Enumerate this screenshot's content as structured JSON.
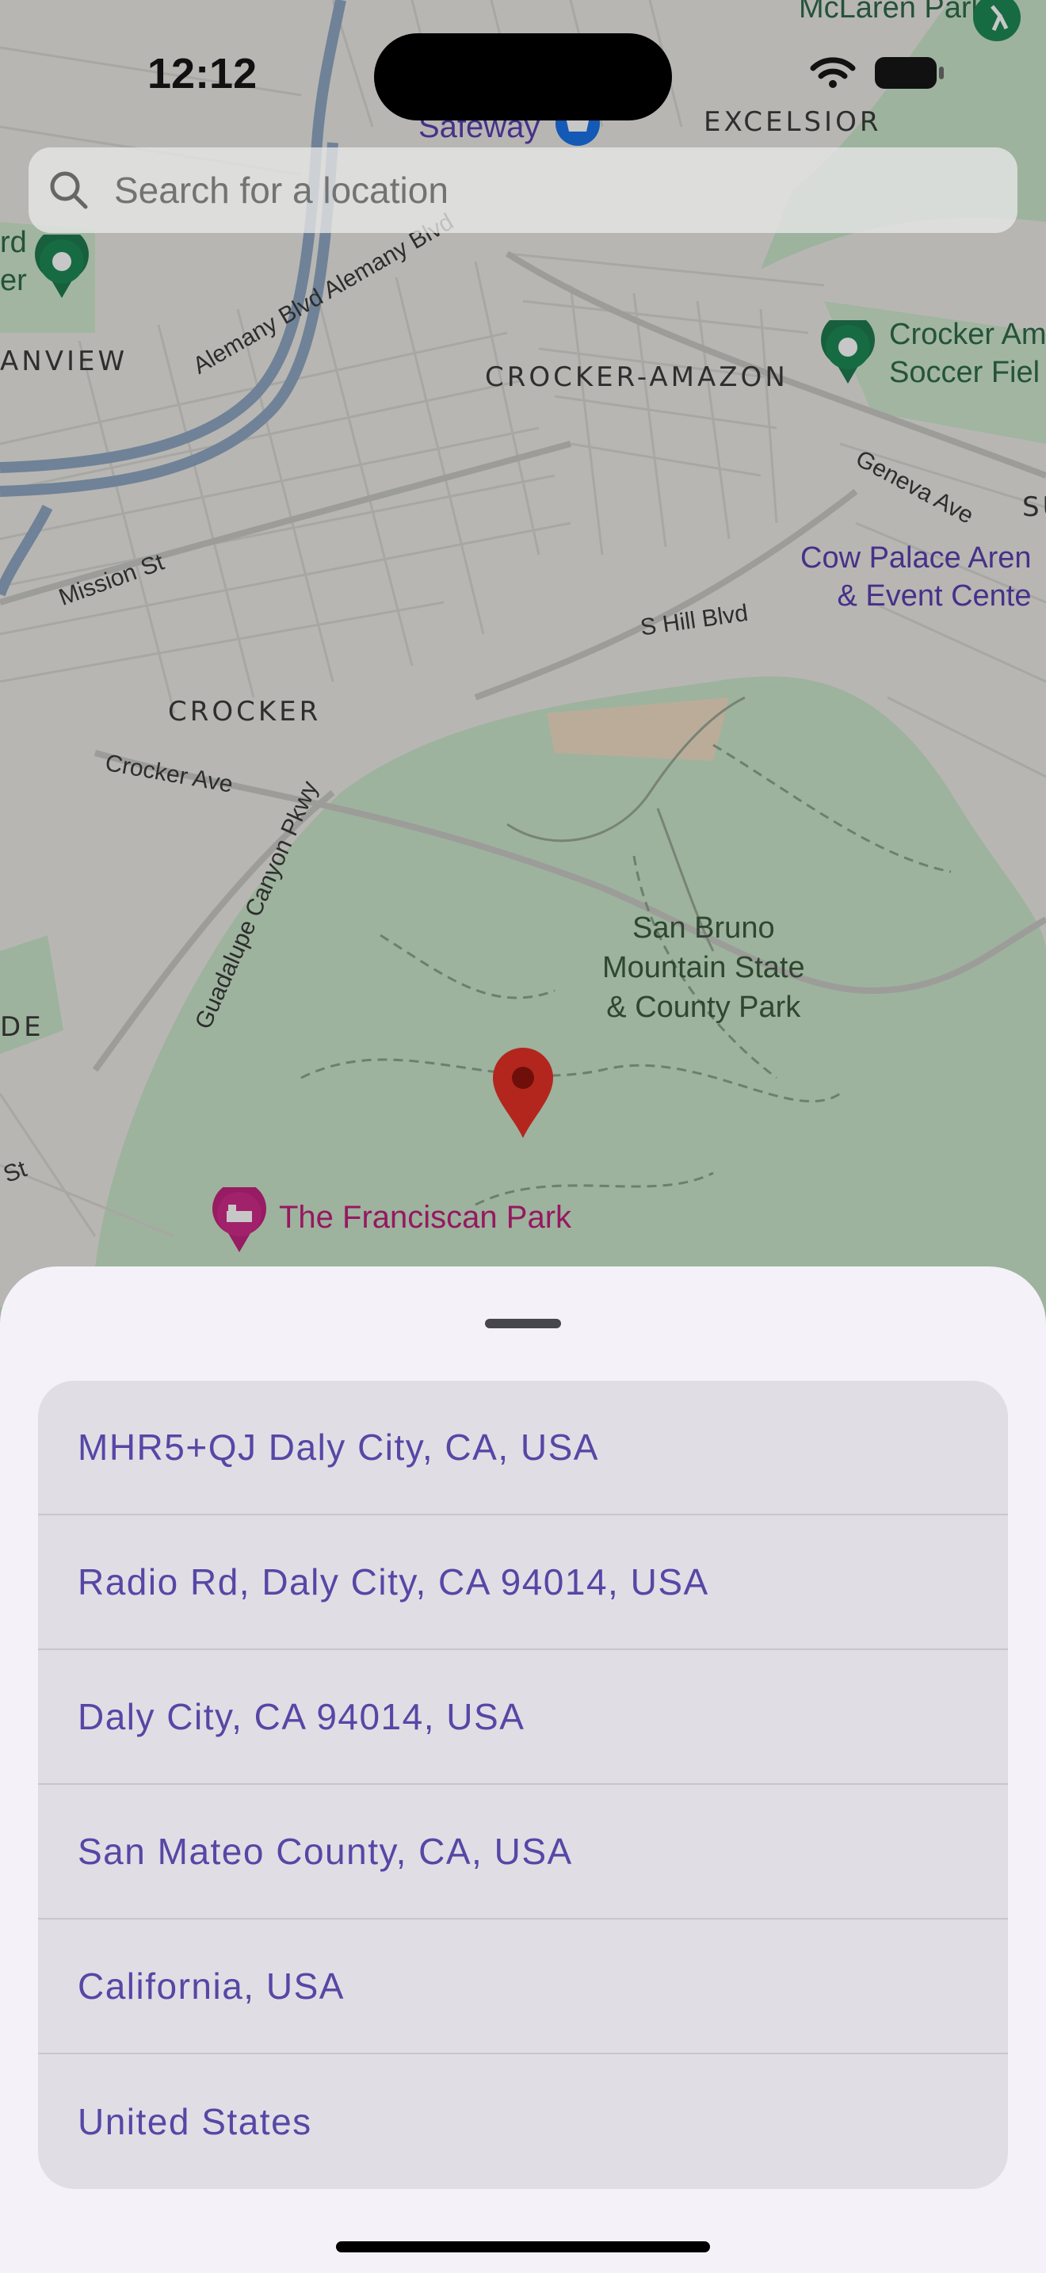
{
  "status_bar": {
    "time": "12:12"
  },
  "search": {
    "placeholder": "Search for a location",
    "value": ""
  },
  "map": {
    "labels": {
      "excelsior": "EXCELSIOR",
      "crocker_amazon": "CROCKER-AMAZON",
      "crocker": "CROCKER",
      "anview": "ANVIEW",
      "de": "DE",
      "su": "SU",
      "alemany": "Alemany Blvd Alemany Blvd",
      "mission_st": "Mission St",
      "crocker_ave": "Crocker Ave",
      "guadalupe": "Guadalupe Canyon Pkwy",
      "geneva": "Geneva Ave",
      "s_hill": "S Hill Blvd",
      "st": "St",
      "mclaren": "McLaren Park",
      "safeway": "Safeway",
      "rd_er": "rd\ner",
      "crocker_soccer": "Crocker Am\nSoccer Fiel",
      "cow_palace": "Cow Palace Aren\n& Event Cente",
      "san_bruno": "San Bruno\nMountain State\n& County Park",
      "franciscan": "The Franciscan Park"
    },
    "icons": [
      "park-pin-icon",
      "soccer-pin-icon",
      "shopping-pin-icon",
      "hotel-pin-icon",
      "location-pin-icon"
    ]
  },
  "results": [
    "MHR5+QJ Daly City, CA, USA",
    "Radio Rd, Daly City, CA 94014, USA",
    "Daly City, CA 94014, USA",
    "San Mateo County, CA, USA",
    "California, USA",
    "United States"
  ],
  "colors": {
    "accent": "#5647a6",
    "sheet": "#f5f1f8",
    "list": "#e0dee4",
    "pin": "#b3261e"
  }
}
